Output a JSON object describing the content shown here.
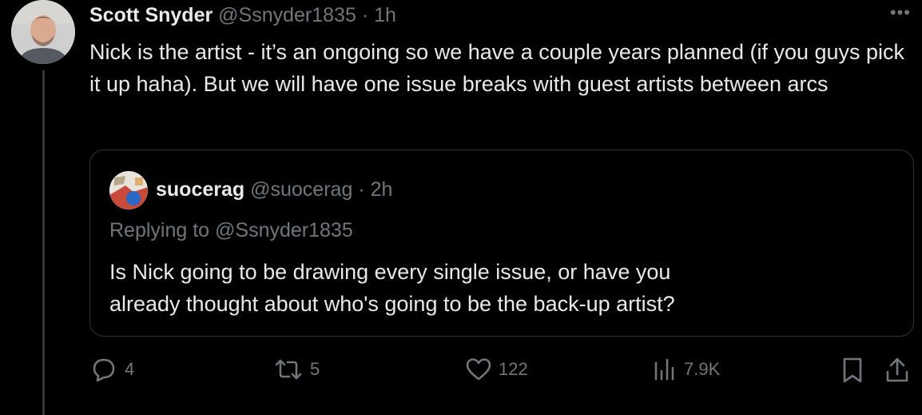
{
  "tweet": {
    "author_name": "Scott Snyder",
    "handle": "@Ssnyder1835",
    "separator": "·",
    "time": "1h",
    "more_icon": "more-icon",
    "text": "Nick is the artist - it’s an ongoing so we have a couple years planned (if you guys pick it up haha). But we will have one issue breaks with guest artists between arcs"
  },
  "quote": {
    "author_name": "suocerag",
    "handle": "@suocerag",
    "separator": "·",
    "time": "2h",
    "replying_to": "Replying to @Ssnyder1835",
    "text_line1": "Is Nick going to be drawing every single issue, or have you",
    "text_line2": "already thought about who's going to be the back-up artist?"
  },
  "actions": {
    "replies": "4",
    "reposts": "5",
    "likes": "122",
    "views": "7.9K",
    "icons": [
      "reply-icon",
      "repost-icon",
      "like-icon",
      "views-icon",
      "bookmark-icon",
      "share-icon"
    ]
  },
  "colors": {
    "background": "#000000",
    "text": "#e7e9ea",
    "muted": "#71767b",
    "border": "#2f3336"
  }
}
